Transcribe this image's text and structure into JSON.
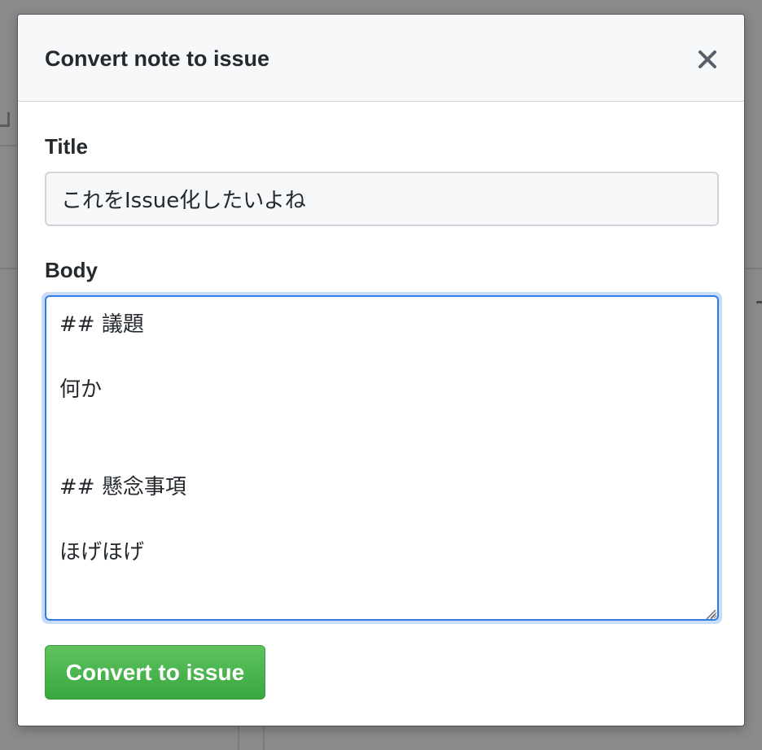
{
  "dialog": {
    "title": "Convert note to issue",
    "close_icon": "close-icon"
  },
  "form": {
    "title_label": "Title",
    "title_value": "これをIssue化したいよね",
    "body_label": "Body",
    "body_value": "## 議題\n\n何か\n\n\n## 懸念事項\n\nほげほげ",
    "submit_label": "Convert to issue"
  },
  "colors": {
    "submit_green": "#3fa844",
    "focus_blue": "#2f7be8",
    "header_bg": "#f6f8fa"
  }
}
